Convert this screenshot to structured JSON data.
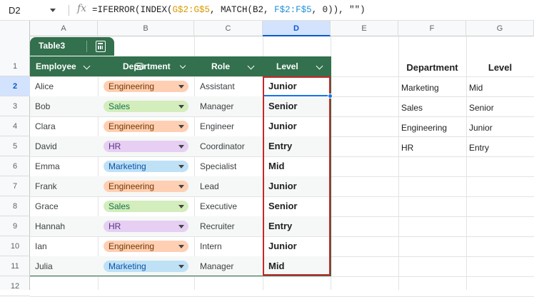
{
  "formula_bar": {
    "cell_ref": "D2",
    "fx_label": "fx",
    "formula_parts": [
      {
        "text": "=IFERROR(INDEX(",
        "color": "default"
      },
      {
        "text": "G$2:G$5",
        "color": "orange"
      },
      {
        "text": ", MATCH(B2, ",
        "color": "default"
      },
      {
        "text": "F$2:F$5",
        "color": "blue"
      },
      {
        "text": ", 0)), \"\")",
        "color": "default"
      }
    ]
  },
  "columns": [
    "A",
    "B",
    "C",
    "D",
    "E",
    "F",
    "G"
  ],
  "selected_column": "D",
  "rows": [
    "1",
    "2",
    "3",
    "4",
    "5",
    "6",
    "7",
    "8",
    "9",
    "10",
    "11",
    "12"
  ],
  "selected_row": "2",
  "table": {
    "name": "Table3",
    "headers": [
      "Employee",
      "Department",
      "Role",
      "Level"
    ],
    "rows": [
      {
        "employee": "Alice",
        "department": "Engineering",
        "role": "Assistant",
        "level": "Junior"
      },
      {
        "employee": "Bob",
        "department": "Sales",
        "role": "Manager",
        "level": "Senior"
      },
      {
        "employee": "Clara",
        "department": "Engineering",
        "role": "Engineer",
        "level": "Junior"
      },
      {
        "employee": "David",
        "department": "HR",
        "role": "Coordinator",
        "level": "Entry"
      },
      {
        "employee": "Emma",
        "department": "Marketing",
        "role": "Specialist",
        "level": "Mid"
      },
      {
        "employee": "Frank",
        "department": "Engineering",
        "role": "Lead",
        "level": "Junior"
      },
      {
        "employee": "Grace",
        "department": "Sales",
        "role": "Executive",
        "level": "Senior"
      },
      {
        "employee": "Hannah",
        "department": "HR",
        "role": "Recruiter",
        "level": "Entry"
      },
      {
        "employee": "Ian",
        "department": "Engineering",
        "role": "Intern",
        "level": "Junior"
      },
      {
        "employee": "Julia",
        "department": "Marketing",
        "role": "Manager",
        "level": "Mid"
      }
    ]
  },
  "department_colors": {
    "Engineering": "#ffcfb3",
    "Sales": "#d4edbc",
    "HR": "#e6cff2",
    "Marketing": "#bfe1f6"
  },
  "department_text_colors": {
    "Engineering": "#753800",
    "Sales": "#11734b",
    "HR": "#5a3286",
    "Marketing": "#0a53a8"
  },
  "lookup": {
    "headers": [
      "Department",
      "Level"
    ],
    "rows": [
      {
        "department": "Marketing",
        "level": "Mid"
      },
      {
        "department": "Sales",
        "level": "Senior"
      },
      {
        "department": "Engineering",
        "level": "Junior"
      },
      {
        "department": "HR",
        "level": "Entry"
      }
    ]
  },
  "colors": {
    "table_header": "#33704d",
    "selection_border": "#c62828",
    "active_cell": "#1a73e8"
  }
}
